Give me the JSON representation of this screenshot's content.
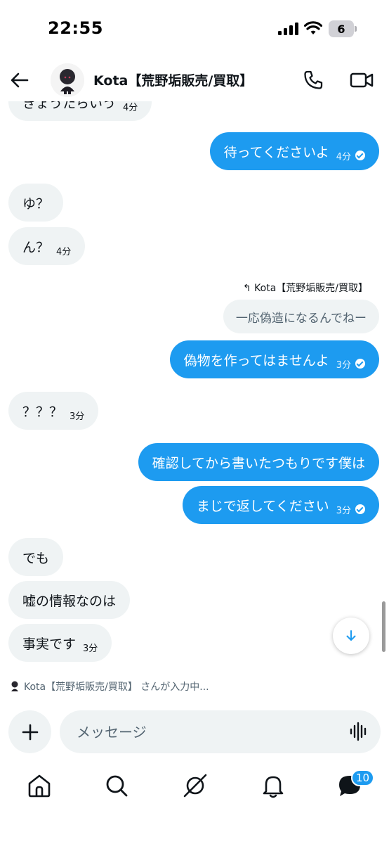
{
  "status_bar": {
    "time": "22:55",
    "battery": "6"
  },
  "header": {
    "contact_name": "Kota【荒野垢販売/買取】"
  },
  "messages": {
    "m0": {
      "text": "きょうたらいう",
      "time": "4分"
    },
    "m1": {
      "text": "待ってくださいよ",
      "time": "4分"
    },
    "m2": {
      "text": "ゆ？"
    },
    "m3": {
      "text": "ん？",
      "time": "4分"
    },
    "reply_to": "Kota【荒野垢販売/買取】",
    "quoted": "一応偽造になるんでねー",
    "m4": {
      "text": "偽物を作ってはませんよ",
      "time": "3分"
    },
    "m5": {
      "text": "？？？",
      "time": "3分"
    },
    "m6": {
      "text": "確認してから書いたつもりです僕は"
    },
    "m7": {
      "text": "まじで返してください",
      "time": "3分"
    },
    "m8": {
      "text": "でも"
    },
    "m9": {
      "text": "嘘の情報なのは"
    },
    "m10": {
      "text": "事実です",
      "time": "3分"
    }
  },
  "typing_indicator": "Kota【荒野垢販売/買取】 さんが入力中...",
  "composer": {
    "placeholder": "メッセージ"
  },
  "tabbar": {
    "messages_badge": "10"
  },
  "colors": {
    "accent": "#1d9bf0",
    "incoming_bubble": "#eff3f4"
  }
}
